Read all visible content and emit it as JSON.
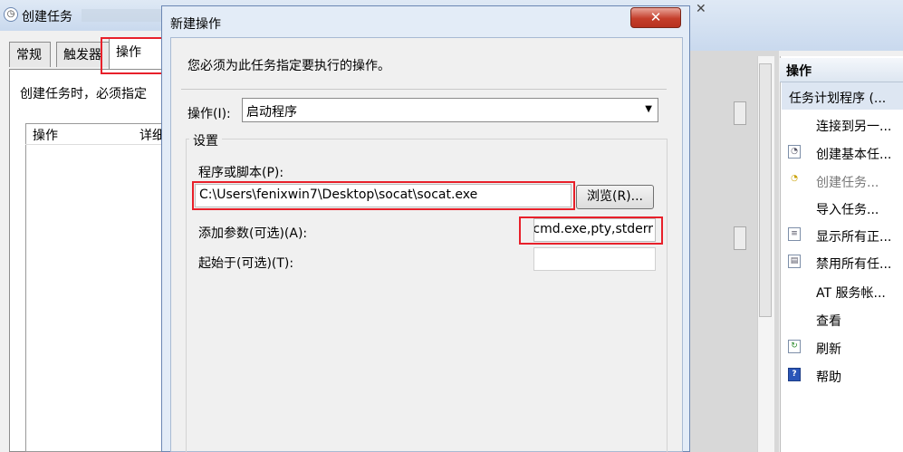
{
  "background_window": {
    "title": "创建任务",
    "tabs": [
      "常规",
      "触发器",
      "操作"
    ],
    "active_tab": "操作",
    "description": "创建任务时，必须指定",
    "columns": [
      "操作",
      "详细"
    ]
  },
  "dialog": {
    "title": "新建操作",
    "close_label": "✕",
    "instruction": "您必须为此任务指定要执行的操作。",
    "action_label": "操作(I):",
    "action_value": "启动程序",
    "settings_group": "设置",
    "program_label": "程序或脚本(P):",
    "program_value": "C:\\Users\\fenixwin7\\Desktop\\socat\\socat.exe",
    "browse_button": "浏览(R)...",
    "args_label": "添加参数(可选)(A):",
    "args_value": "cmd.exe,pty,stderr",
    "start_in_label": "起始于(可选)(T):",
    "start_in_value": ""
  },
  "actions_pane": {
    "header": "操作",
    "section": "任务计划程序 (...",
    "items": [
      {
        "label": "连接到另一...",
        "icon": "none-icon",
        "enabled": true
      },
      {
        "label": "创建基本任...",
        "icon": "basic-task-icon",
        "enabled": true
      },
      {
        "label": "创建任务...",
        "icon": "create-task-icon",
        "enabled": false
      },
      {
        "label": "导入任务...",
        "icon": "none-icon",
        "enabled": true
      },
      {
        "label": "显示所有正...",
        "icon": "list-icon",
        "enabled": true
      },
      {
        "label": "禁用所有任...",
        "icon": "disable-icon",
        "enabled": true
      },
      {
        "label": "AT 服务帐...",
        "icon": "none-icon",
        "enabled": true
      },
      {
        "label": "查看",
        "icon": "none-icon",
        "enabled": true
      },
      {
        "label": "刷新",
        "icon": "refresh-icon",
        "enabled": true
      },
      {
        "label": "帮助",
        "icon": "help-icon",
        "enabled": true
      }
    ]
  },
  "colors": {
    "highlight_red": "#e8202a",
    "close_red": "#c43e2a",
    "titlebar_blue": "#dfe9f5"
  }
}
